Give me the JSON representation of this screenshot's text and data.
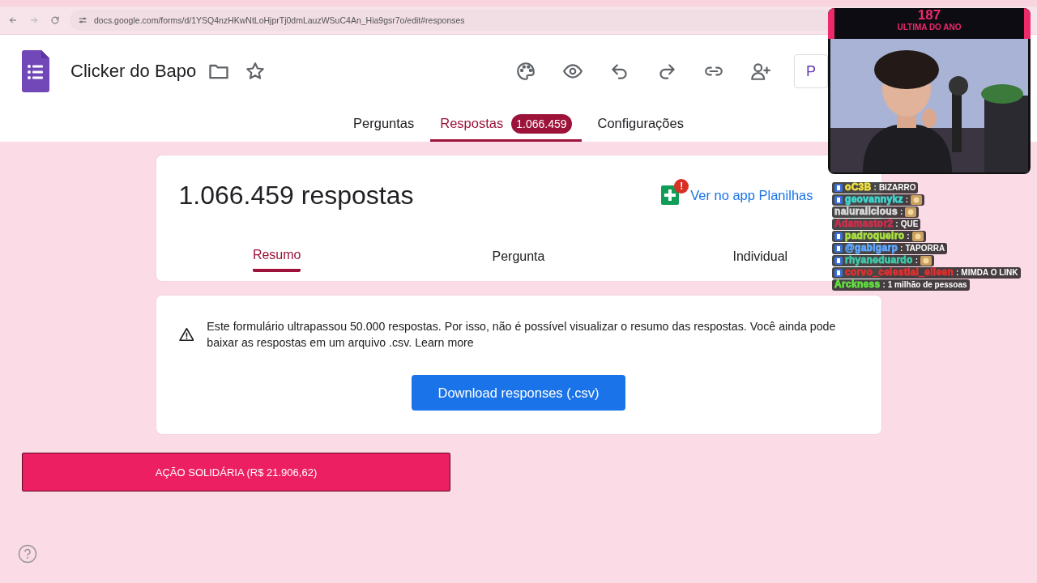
{
  "browser": {
    "url": "docs.google.com/forms/d/1YSQ4nzHKwNtLoHjprTj0dmLauzWSuC4An_Hia9gsr7o/edit#responses"
  },
  "header": {
    "title": "Clicker do Bapo",
    "publish_label": "P"
  },
  "tabs": [
    {
      "label": "Perguntas",
      "selected": false
    },
    {
      "label": "Respostas",
      "selected": true,
      "count": "1.066.459"
    },
    {
      "label": "Configurações",
      "selected": false
    }
  ],
  "summary": {
    "heading": "1.066.459 respostas",
    "sheets_link": "Ver no app Planilhas",
    "sheets_alert": "!",
    "subtabs": [
      {
        "label": "Resumo",
        "selected": true
      },
      {
        "label": "Pergunta",
        "selected": false
      },
      {
        "label": "Individual",
        "selected": false
      }
    ]
  },
  "notice": {
    "text": "Este formulário ultrapassou 50.000 respostas. Por isso, não é possível visualizar o resumo das respostas. Você ainda pode baixar as respostas em um arquivo .csv.",
    "link": "Learn more",
    "button": "Download responses (.csv)"
  },
  "donation_button": "AÇÃO SOLIDÁRIA (R$ 21.906,62)",
  "webcam": {
    "kind": "picture",
    "counter": "187",
    "caption": "ULTIMA DO ANO"
  },
  "chat": {
    "separator": ":",
    "messages": [
      {
        "user": "oC3B",
        "color": "#f0e040",
        "badge": true,
        "kind": "text",
        "text": "BIZARRO"
      },
      {
        "user": "geovannykz",
        "color": "#3fd8d0",
        "badge": true,
        "kind": "emote"
      },
      {
        "user": "naluralicious",
        "color": "#d8d8d8",
        "badge": false,
        "kind": "emote"
      },
      {
        "user": "Adamastor2",
        "color": "#c8304e",
        "badge": false,
        "kind": "text",
        "text": "QUE"
      },
      {
        "user": "padroqueiro",
        "color": "#a8e040",
        "badge": true,
        "kind": "emote"
      },
      {
        "user": "@gabigarp",
        "color": "#5ea8ff",
        "badge": true,
        "kind": "text",
        "text": "TAPORRA"
      },
      {
        "user": "rhyaneduardo",
        "color": "#40c8a8",
        "badge": true,
        "kind": "emote"
      },
      {
        "user": "corvo_celestial_eileen",
        "color": "#e03030",
        "badge": true,
        "kind": "text",
        "text": "MIMDA O LINK"
      },
      {
        "user": "Arckness",
        "color": "#60e040",
        "badge": false,
        "kind": "text",
        "text": "1 milhão de pessoas"
      }
    ]
  }
}
